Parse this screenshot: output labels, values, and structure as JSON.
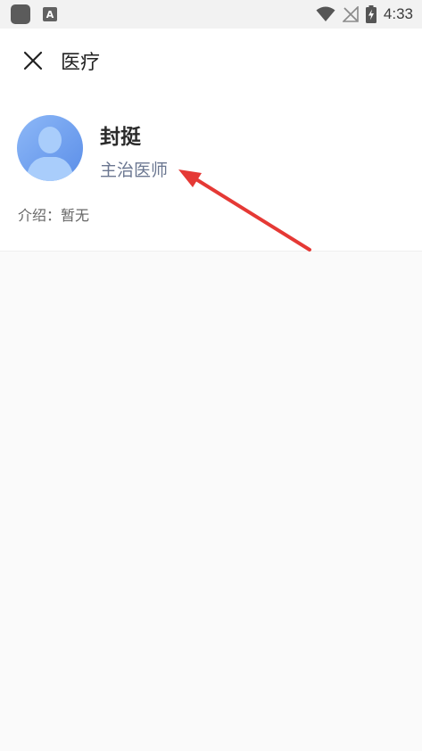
{
  "status_bar": {
    "a_icon_text": "A",
    "time": "4:33",
    "icons": [
      "app-icon",
      "text-app-icon",
      "wifi-icon",
      "no-signal-icon",
      "battery-charging-icon"
    ]
  },
  "header": {
    "title": "医疗",
    "close_icon": "close-icon"
  },
  "profile": {
    "name": "封挺",
    "title": "主治医师",
    "intro": "介绍：暂无"
  },
  "colors": {
    "avatar": "#7aa7f2",
    "title_text": "#6b7791",
    "annotation_arrow": "#e53935",
    "page_background": "#fafafa"
  }
}
